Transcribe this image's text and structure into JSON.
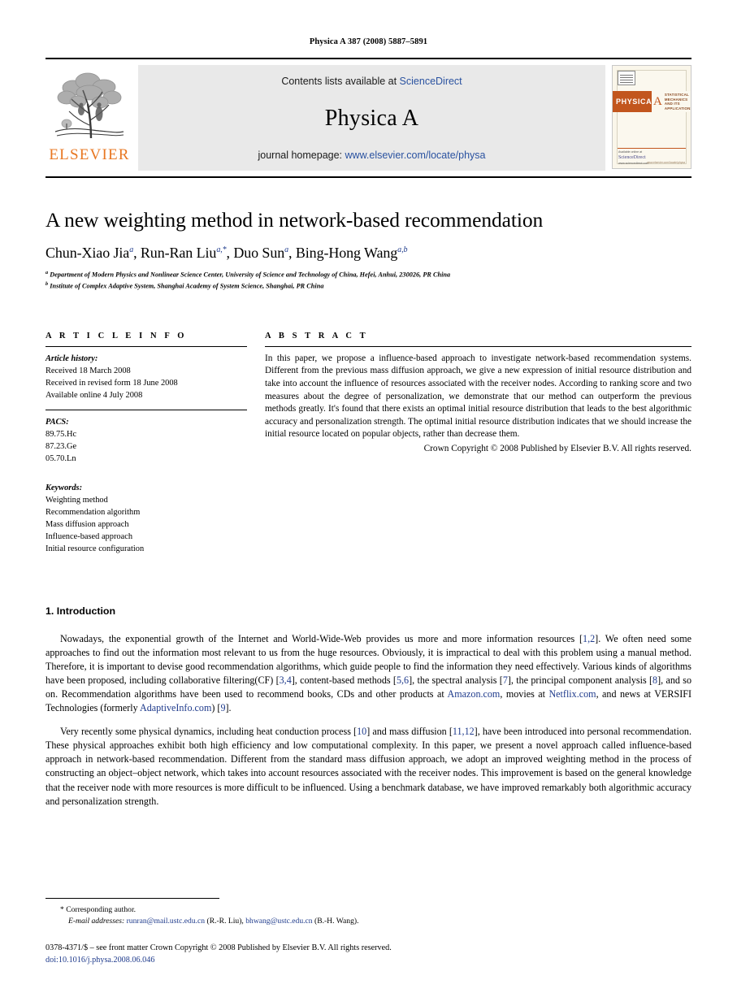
{
  "running_head": "Physica A 387 (2008) 5887–5891",
  "masthead": {
    "publisher_name": "ELSEVIER",
    "contents_prefix": "Contents lists available at ",
    "contents_link": "ScienceDirect",
    "journal_name": "Physica A",
    "homepage_prefix": "journal homepage: ",
    "homepage_link": "www.elsevier.com/locate/physa",
    "cover": {
      "title": "PHYSICA",
      "volume_letter": "A",
      "subtitle": "STATISTICAL MECHANICS AND ITS APPLICATIONS",
      "foot_left": "Available online at",
      "foot_left2": "ScienceDirect",
      "foot_left3": "www.sciencedirect.com",
      "foot_right": "www.elsevier.com/locate/physa"
    }
  },
  "article": {
    "title": "A new weighting method in network-based recommendation",
    "authors": [
      {
        "name": "Chun-Xiao Jia",
        "sup": "a",
        "sep": ", "
      },
      {
        "name": "Run-Ran Liu",
        "sup": "a,*",
        "sep": ", "
      },
      {
        "name": "Duo Sun",
        "sup": "a",
        "sep": ", "
      },
      {
        "name": "Bing-Hong Wang",
        "sup": "a,b",
        "sep": ""
      }
    ],
    "affiliations": [
      {
        "mark": "a",
        "text": "Department of Modern Physics and Nonlinear Science Center, University of Science and Technology of China, Hefei, Anhui, 230026, PR China"
      },
      {
        "mark": "b",
        "text": "Institute of Complex Adaptive System, Shanghai Academy of System Science, Shanghai, PR China"
      }
    ]
  },
  "article_info": {
    "heading": "A R T I C L E    I N F O",
    "history_label": "Article history:",
    "history": [
      "Received 18 March 2008",
      "Received in revised form 18 June 2008",
      "Available online 4 July 2008"
    ],
    "pacs_label": "PACS:",
    "pacs": [
      "89.75.Hc",
      "87.23.Ge",
      "05.70.Ln"
    ],
    "keywords_label": "Keywords:",
    "keywords": [
      "Weighting method",
      "Recommendation algorithm",
      "Mass diffusion approach",
      "Influence-based approach",
      "Initial resource configuration"
    ]
  },
  "abstract": {
    "heading": "A B S T R A C T",
    "text": "In this paper, we propose a influence-based approach to investigate network-based recommendation systems. Different from the previous mass diffusion approach, we give a new expression of initial resource distribution and take into account the influence of resources associated with the receiver nodes. According to ranking score and two measures about the degree of personalization, we demonstrate that our method can outperform the previous methods greatly. It's found that there exists an optimal initial resource distribution that leads to the best algorithmic accuracy and personalization strength. The optimal initial resource distribution indicates that we should increase the initial resource located on popular objects, rather than decrease them.",
    "copyright": "Crown Copyright © 2008 Published by Elsevier B.V. All rights reserved."
  },
  "introduction": {
    "heading": "1. Introduction",
    "paragraph1_parts": [
      "Nowadays, the exponential growth of the Internet and World-Wide-Web provides us more and more information resources [",
      "1,2",
      "]. We often need some approaches to find out the information most relevant to us from the huge resources. Obviously, it is impractical to deal with this problem using a manual method. Therefore, it is important to devise good recommendation algorithms, which guide people to find the information they need effectively. Various kinds of algorithms have been proposed, including collaborative filtering(CF) [",
      "3,4",
      "], content-based methods [",
      "5,6",
      "], the spectral analysis [",
      "7",
      "], the principal component analysis [",
      "8",
      "], and so on. Recommendation algorithms have been used to recommend books, CDs and other products at ",
      "Amazon.com",
      ", movies at ",
      "Netflix.com",
      ", and news at VERSIFI Technologies (formerly ",
      "AdaptiveInfo.com",
      ") [",
      "9",
      "]."
    ],
    "paragraph2_parts": [
      "Very recently some physical dynamics, including heat conduction process [",
      "10",
      "] and mass diffusion [",
      "11,12",
      "], have been introduced into personal recommendation. These physical approaches exhibit both high efficiency and low computational complexity. In this paper, we present a novel approach called influence-based approach in network-based recommendation. Different from the standard mass diffusion approach, we adopt an improved weighting method in the process of constructing an object–object network, which takes into account resources associated with the receiver nodes. This improvement is based on the general knowledge that the receiver node with more resources is more difficult to be influenced. Using a benchmark database, we have improved remarkably both algorithmic accuracy and personalization strength."
    ]
  },
  "footnotes": {
    "corresponding_mark": "*",
    "corresponding_text": "Corresponding author.",
    "email_label": "E-mail addresses:",
    "email1": "runran@mail.ustc.edu.cn",
    "email1_who": "(R.-R. Liu),",
    "email2": "bhwang@ustc.edu.cn",
    "email2_who": "(B.-H. Wang).",
    "issn_line": "0378-4371/$ – see front matter Crown Copyright © 2008 Published by Elsevier B.V. All rights reserved.",
    "doi_line": "doi:10.1016/j.physa.2008.06.046"
  },
  "colors": {
    "link": "#1f3b8c",
    "sd_link": "#2a52a0",
    "elsevier_orange": "#E87722",
    "masthead_bg": "#e9e9e9",
    "cover_band": "#C2561E"
  }
}
